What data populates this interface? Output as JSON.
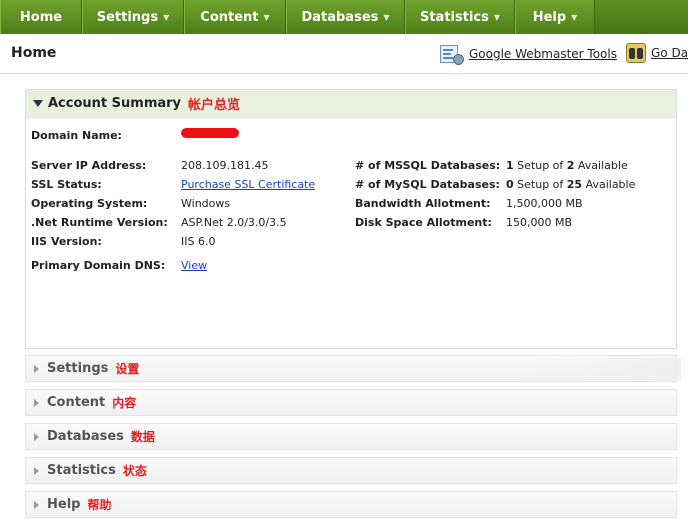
{
  "nav": {
    "items": [
      {
        "label": "Home",
        "caret": false
      },
      {
        "label": "Settings",
        "caret": true
      },
      {
        "label": "Content",
        "caret": true
      },
      {
        "label": "Databases",
        "caret": true
      },
      {
        "label": "Statistics",
        "caret": true
      },
      {
        "label": "Help",
        "caret": true
      }
    ]
  },
  "header": {
    "title": "Home",
    "tools": [
      {
        "label": "Google Webmaster Tools",
        "icon": "webmaster-tools-icon"
      },
      {
        "label": "Go Da",
        "icon": "binoculars-icon"
      }
    ]
  },
  "account_summary": {
    "title": "Account Summary",
    "annotation": "帐户总览",
    "domain_name_label": "Domain Name:",
    "left_rows": [
      {
        "label": "Server IP Address:",
        "value": "208.109.181.45"
      },
      {
        "label": "SSL Status:",
        "value": "Purchase SSL Certificate",
        "link": true
      },
      {
        "label": "Operating System:",
        "value": "Windows"
      },
      {
        "label": ".Net Runtime Version:",
        "value": "ASP.Net 2.0/3.0/3.5"
      },
      {
        "label": "IIS Version:",
        "value": "IIS 6.0"
      }
    ],
    "primary_dns_label": "Primary Domain DNS:",
    "primary_dns_value": "View",
    "right_rows": [
      {
        "label": "# of MSSQL Databases:",
        "setup": "1",
        "mid": " Setup of ",
        "avail": "2",
        "tail": " Available"
      },
      {
        "label": "# of MySQL Databases:",
        "setup": "0",
        "mid": " Setup of ",
        "avail": "25",
        "tail": " Available"
      },
      {
        "label": "Bandwidth Allotment:",
        "value": "1,500,000 MB"
      },
      {
        "label": "Disk Space Allotment:",
        "value": "150,000 MB"
      }
    ]
  },
  "sections": [
    {
      "title": "Settings",
      "annotation": "设置"
    },
    {
      "title": "Content",
      "annotation": "内容"
    },
    {
      "title": "Databases",
      "annotation": "数据"
    },
    {
      "title": "Statistics",
      "annotation": "状态"
    },
    {
      "title": "Help",
      "annotation": "帮助"
    }
  ],
  "colors": {
    "nav_green": "#5f8e22",
    "panel_header": "#e9f1de",
    "annotation_red": "#e02020",
    "link_blue": "#1a3fbf"
  }
}
